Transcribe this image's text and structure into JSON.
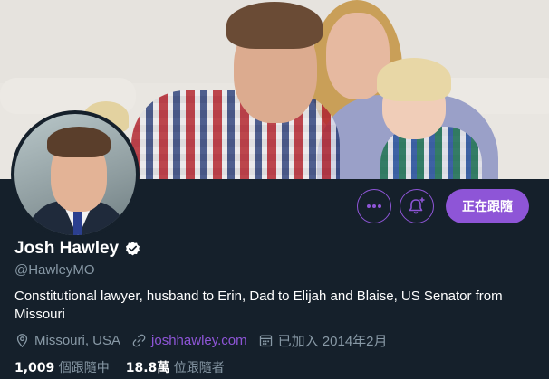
{
  "profile": {
    "name": "Josh Hawley",
    "handle": "@HawleyMO",
    "bio": "Constitutional lawyer, husband to Erin, Dad to Elijah and Blaise, US Senator from Missouri",
    "location": "Missouri, USA",
    "website": "joshhawley.com",
    "joined": "已加入 2014年2月"
  },
  "actions": {
    "follow_label": "正在跟隨",
    "more_icon": "more-dots-icon",
    "notify_icon": "bell-plus-icon"
  },
  "stats": {
    "following_count": "1,009",
    "following_unit": "個",
    "following_label": "跟隨中",
    "followers_count": "18.8萬",
    "followers_unit": "位",
    "followers_label": "跟隨者"
  },
  "colors": {
    "background": "#15202b",
    "accent": "#8e55d7",
    "secondary_text": "#8899a6",
    "verified_badge": "#ffffff"
  }
}
